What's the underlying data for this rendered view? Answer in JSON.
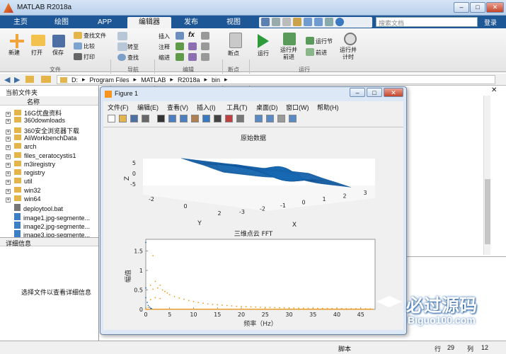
{
  "app": {
    "title": "MATLAB R2018a"
  },
  "main_tabs": [
    "主页",
    "绘图",
    "APP",
    "编辑器",
    "发布",
    "视图"
  ],
  "search": {
    "placeholder": "搜索文档",
    "login": "登录"
  },
  "toolstrip": {
    "file": {
      "new": "新建",
      "open": "打开",
      "save": "保存",
      "find_files": "查找文件",
      "compare": "比较",
      "print": "打印",
      "section": "文件"
    },
    "nav": {
      "goto": "转至",
      "find": "查找",
      "section": "导航"
    },
    "edit": {
      "insert": "插入",
      "comment": "注释",
      "indent": "缩进",
      "fx": "fx",
      "section": "编辑"
    },
    "breakpoints": {
      "label": "断点",
      "section": "断点"
    },
    "run": {
      "run": "运行",
      "run_advance": "运行并\n前进",
      "run_section": "运行节",
      "advance": "前进",
      "run_time": "运行并\n计时",
      "section": "运行"
    }
  },
  "address": [
    "D:",
    "Program Files",
    "MATLAB",
    "R2018a",
    "bin"
  ],
  "left_panel": {
    "title": "当前文件夹",
    "column": "名称",
    "folders": [
      "16G优盘资料",
      "360downloads",
      "360安全浏览器下载",
      "AliWorkbenchData",
      "arch",
      "files_ceratocystis1",
      "m3iregistry",
      "registry",
      "util",
      "win32",
      "win64"
    ],
    "files": [
      "deploytool.bat",
      "image1.jpg-segmente...",
      "image2.jpg-segmente...",
      "image3.jpg-segmente..."
    ],
    "details_title": "详细信息",
    "details_hint": "选择文件以查看详细信息"
  },
  "figure": {
    "title": "Figure 1",
    "menu": [
      "文件(F)",
      "编辑(E)",
      "查看(V)",
      "插入(I)",
      "工具(T)",
      "桌面(D)",
      "窗口(W)",
      "帮助(H)"
    ]
  },
  "status": {
    "script": "脚本",
    "row_label": "行",
    "row": "29",
    "col_label": "列",
    "col": "12"
  },
  "watermark": {
    "text": "必过源码",
    "url": "Biguo100.com"
  },
  "chart_data": [
    {
      "type": "surface",
      "title": "原始数据",
      "xlabel": "X",
      "ylabel": "Y",
      "zlabel": "Z",
      "x_ticks": [
        "-3",
        "-2",
        "-1",
        "0",
        "1",
        "2",
        "3"
      ],
      "y_ticks": [
        "-2",
        "0",
        "2"
      ],
      "z_ticks": [
        "5",
        "0",
        "-5"
      ],
      "surface_color": "#1a6fba"
    },
    {
      "type": "scatter",
      "title": "三维点云 FFT",
      "xlabel": "频率（Hz）",
      "ylabel": "幅值",
      "xlim": [
        0,
        48
      ],
      "ylim": [
        0,
        1.8
      ],
      "x_ticks": [
        0,
        5,
        10,
        15,
        20,
        25,
        30,
        35,
        40,
        45
      ],
      "y_ticks": [
        0,
        0.5,
        1,
        1.5
      ],
      "series": [
        {
          "color": "#1a6fba",
          "x": [
            0,
            0,
            0,
            0.3,
            0.5,
            0.8,
            1,
            1.2
          ],
          "y": [
            1.72,
            0.55,
            0.3,
            0.18,
            0.1,
            0.06,
            0.03,
            0.02
          ]
        },
        {
          "color": "#ef9a1e",
          "x": [
            0.5,
            1,
            1,
            1.5,
            1.5,
            2,
            2,
            2.5,
            3,
            3,
            3.5,
            4,
            4.5,
            5,
            6,
            7,
            8,
            9,
            10,
            11,
            12,
            13,
            14,
            15,
            16,
            17,
            18,
            19,
            20,
            21,
            22,
            23,
            24,
            25,
            26,
            27,
            28,
            29,
            30,
            31,
            32,
            33,
            34,
            35,
            36,
            37,
            38,
            39,
            40,
            41,
            42,
            43,
            44,
            45,
            46,
            47
          ],
          "y": [
            0.05,
            0.25,
            0.62,
            0.52,
            1.38,
            0.72,
            0.3,
            0.55,
            0.62,
            0.28,
            0.5,
            0.46,
            0.42,
            0.38,
            0.33,
            0.29,
            0.26,
            0.23,
            0.2,
            0.18,
            0.16,
            0.14,
            0.13,
            0.12,
            0.11,
            0.1,
            0.09,
            0.08,
            0.075,
            0.07,
            0.065,
            0.06,
            0.055,
            0.05,
            0.048,
            0.045,
            0.042,
            0.04,
            0.038,
            0.036,
            0.034,
            0.032,
            0.03,
            0.028,
            0.027,
            0.026,
            0.025,
            0.024,
            0.023,
            0.022,
            0.021,
            0.02,
            0.019,
            0.018,
            0.017,
            0.016
          ]
        }
      ]
    }
  ]
}
